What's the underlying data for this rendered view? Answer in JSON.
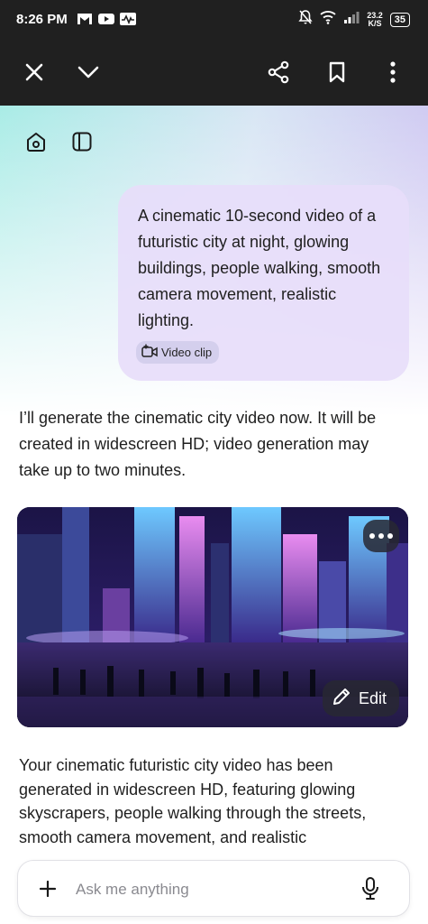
{
  "status_bar": {
    "time": "8:26 PM",
    "app_icons": [
      "gmail-icon",
      "youtube-icon",
      "activity-icon"
    ],
    "net_speed_value": "23.2",
    "net_speed_unit": "K/S",
    "battery": "35",
    "system_icons": [
      "mute-icon",
      "wifi-icon",
      "signal-icon"
    ]
  },
  "toolbar": {
    "left_icons": [
      "close-icon",
      "chevron-down-icon"
    ],
    "right_icons": [
      "share-icon",
      "bookmark-icon",
      "more-vertical-icon"
    ]
  },
  "header_icons": [
    "home-icon",
    "sidebar-icon"
  ],
  "conversation": {
    "user_message": "A cinematic 10-second video of a futuristic city at night, glowing buildings, people walking, smooth camera movement, realistic lighting.",
    "attachment_chip": "Video clip",
    "assistant_reply": "I’ll generate the cinematic city video now. It will be created in widescreen HD; video generation may take up to two minutes.",
    "media": {
      "edit_label": "Edit"
    },
    "assistant_summary": "Your cinematic futuristic city video has been generated in widescreen HD, featuring glowing skyscrapers, people walking through the streets, smooth camera movement, and realistic"
  },
  "composer": {
    "placeholder": "Ask me anything"
  }
}
